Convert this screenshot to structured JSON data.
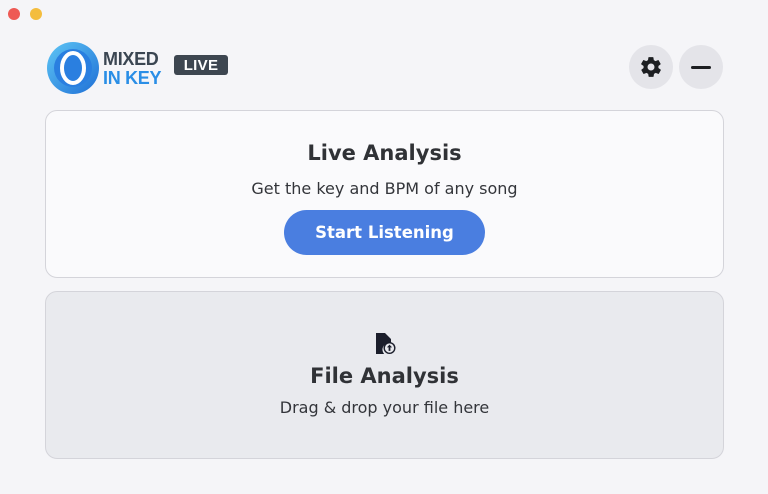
{
  "window": {
    "controls": [
      "close",
      "minimize"
    ]
  },
  "header": {
    "logo_line1": "MIXED",
    "logo_line2": "IN KEY",
    "logo_badge": "LIVE",
    "settings_icon": "gear-icon",
    "minimize_icon": "minus-icon"
  },
  "live_analysis": {
    "title": "Live Analysis",
    "subtitle": "Get the key and BPM of any song",
    "button_label": "Start Listening"
  },
  "file_analysis": {
    "icon": "file-add-icon",
    "title": "File Analysis",
    "subtitle": "Drag & drop your file here"
  },
  "colors": {
    "accent": "#4a7ee0",
    "logo_blue": "#2a8ee6",
    "badge_bg": "#3d4650"
  }
}
